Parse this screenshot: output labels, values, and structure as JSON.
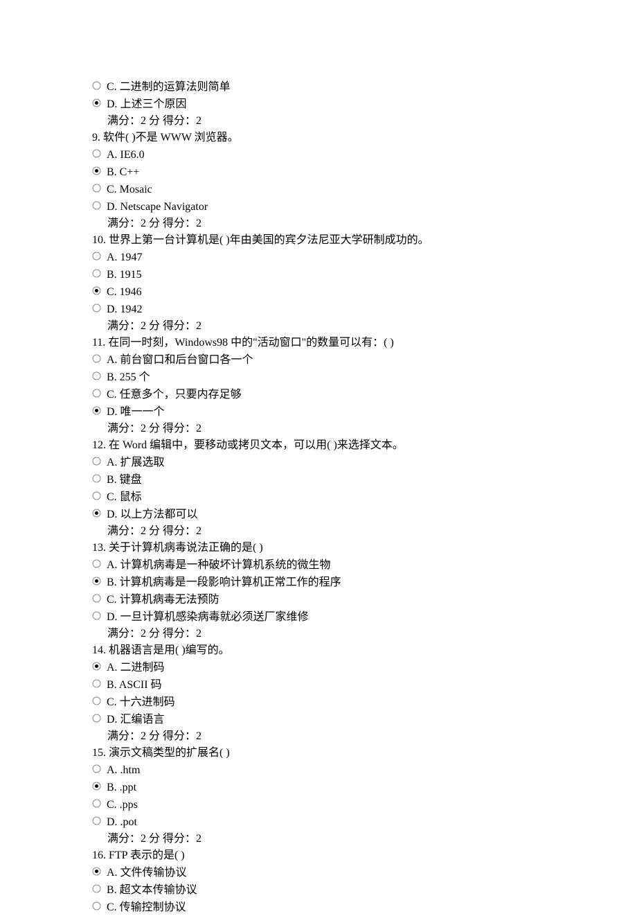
{
  "score_line": "满分：2 分 得分：2",
  "questions": [
    {
      "number": "",
      "stem": "",
      "options": [
        {
          "label": "C. 二进制的运算法则简单",
          "selected": false,
          "en": false
        },
        {
          "label": "D. 上述三个原因",
          "selected": true,
          "en": false
        }
      ]
    },
    {
      "number": "9.",
      "stem": "软件( )不是 WWW 浏览器。",
      "options": [
        {
          "label": "A. IE6.0",
          "selected": false,
          "en": true
        },
        {
          "label": "B. C++",
          "selected": true,
          "en": true
        },
        {
          "label": "C. Mosaic",
          "selected": false,
          "en": true
        },
        {
          "label": "D. Netscape Navigator",
          "selected": false,
          "en": true
        }
      ]
    },
    {
      "number": "10.",
      "stem": "世界上第一台计算机是( )年由美国的宾夕法尼亚大学研制成功的。",
      "options": [
        {
          "label": "A. 1947",
          "selected": false,
          "en": true
        },
        {
          "label": "B. 1915",
          "selected": false,
          "en": true
        },
        {
          "label": "C. 1946",
          "selected": true,
          "en": true
        },
        {
          "label": "D. 1942",
          "selected": false,
          "en": true
        }
      ]
    },
    {
      "number": "11.",
      "stem": "在同一时刻，Windows98 中的\"活动窗口\"的数量可以有：( )",
      "options": [
        {
          "label": "A. 前台窗口和后台窗口各一个",
          "selected": false,
          "en": false
        },
        {
          "label": "B. 255 个",
          "selected": false,
          "en": false
        },
        {
          "label": "C. 任意多个，只要内存足够",
          "selected": false,
          "en": false
        },
        {
          "label": "D. 唯一一个",
          "selected": true,
          "en": false
        }
      ]
    },
    {
      "number": "12.",
      "stem": "在 Word 编辑中，要移动或拷贝文本，可以用( )来选择文本。",
      "options": [
        {
          "label": "A. 扩展选取",
          "selected": false,
          "en": false
        },
        {
          "label": "B. 键盘",
          "selected": false,
          "en": false
        },
        {
          "label": "C. 鼠标",
          "selected": false,
          "en": false
        },
        {
          "label": "D. 以上方法都可以",
          "selected": true,
          "en": false
        }
      ]
    },
    {
      "number": "13.",
      "stem": "关于计算机病毒说法正确的是( )",
      "options": [
        {
          "label": "A. 计算机病毒是一种破坏计算机系统的微生物",
          "selected": false,
          "en": false
        },
        {
          "label": "B. 计算机病毒是一段影响计算机正常工作的程序",
          "selected": true,
          "en": false
        },
        {
          "label": "C. 计算机病毒无法预防",
          "selected": false,
          "en": false
        },
        {
          "label": "D. 一旦计算机感染病毒就必须送厂家维修",
          "selected": false,
          "en": false
        }
      ]
    },
    {
      "number": "14.",
      "stem": "机器语言是用( )编写的。",
      "options": [
        {
          "label": "A. 二进制码",
          "selected": true,
          "en": false
        },
        {
          "label": "B. ASCII 码",
          "selected": false,
          "en": false
        },
        {
          "label": "C. 十六进制码",
          "selected": false,
          "en": false
        },
        {
          "label": "D. 汇编语言",
          "selected": false,
          "en": false
        }
      ]
    },
    {
      "number": "15.",
      "stem": "演示文稿类型的扩展名( )",
      "options": [
        {
          "label": "A. .htm",
          "selected": false,
          "en": true
        },
        {
          "label": "B. .ppt",
          "selected": true,
          "en": true
        },
        {
          "label": "C. .pps",
          "selected": false,
          "en": true
        },
        {
          "label": "D. .pot",
          "selected": false,
          "en": true
        }
      ]
    },
    {
      "number": "16.",
      "stem": "FTP 表示的是( )",
      "options": [
        {
          "label": "A. 文件传输协议",
          "selected": true,
          "en": false
        },
        {
          "label": "B. 超文本传输协议",
          "selected": false,
          "en": false
        },
        {
          "label": "C. 传输控制协议",
          "selected": false,
          "en": false
        }
      ],
      "no_score": true
    }
  ]
}
